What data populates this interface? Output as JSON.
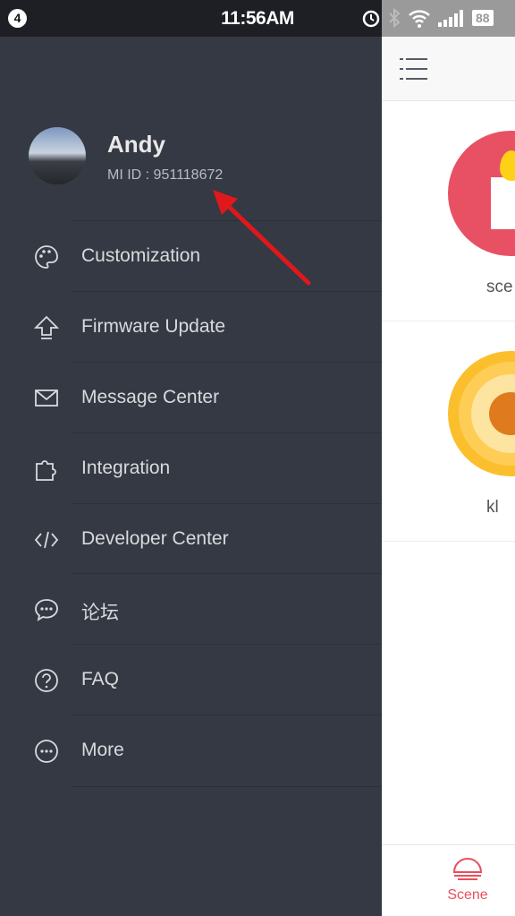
{
  "status_bar": {
    "notification_count": "4",
    "time": "11:56AM",
    "battery": "88"
  },
  "profile": {
    "name": "Andy",
    "mi_id": "MI ID : 951118672"
  },
  "menu": [
    {
      "label": "Customization",
      "icon": "palette-icon"
    },
    {
      "label": "Firmware Update",
      "icon": "upload-arrow-icon"
    },
    {
      "label": "Message Center",
      "icon": "envelope-icon"
    },
    {
      "label": "Integration",
      "icon": "puzzle-icon"
    },
    {
      "label": "Developer Center",
      "icon": "code-icon"
    },
    {
      "label": "论坛",
      "icon": "chat-bubble-icon"
    },
    {
      "label": "FAQ",
      "icon": "question-icon"
    },
    {
      "label": "More",
      "icon": "more-dots-icon"
    }
  ],
  "scenes": [
    {
      "label": "sce",
      "icon": "candle-icon",
      "color": "#e85163"
    },
    {
      "label": "kl",
      "icon": "sun-icon",
      "color": "#fbbf2e"
    }
  ],
  "bottom_nav": {
    "active_tab": "Scene",
    "accent": "#e8505b"
  },
  "annotation": {
    "color": "#e0181b"
  }
}
